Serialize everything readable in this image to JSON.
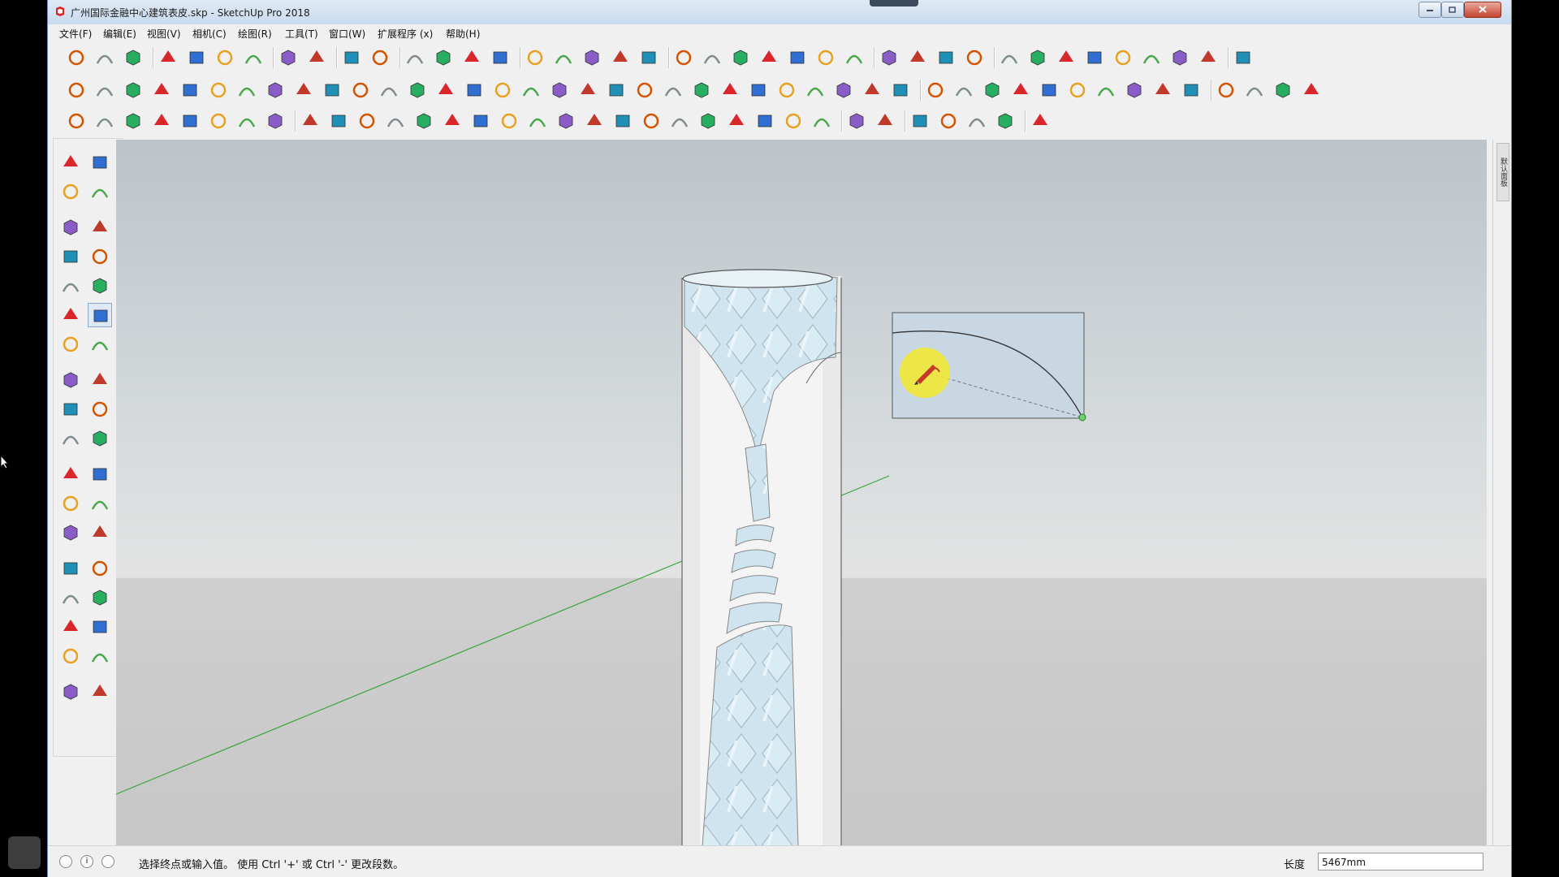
{
  "window": {
    "title": "广州国际金融中心建筑表皮.skp - SketchUp Pro 2018"
  },
  "menu": [
    "文件(F)",
    "编辑(E)",
    "视图(V)",
    "相机(C)",
    "绘图(R)",
    "工具(T)",
    "窗口(W)",
    "扩展程序 (x)",
    "帮助(H)"
  ],
  "toolbars": {
    "row1": [
      "new",
      "open",
      "save",
      "cut",
      "copy",
      "paste",
      "erase",
      "undo",
      "redo",
      "print",
      "model-info",
      "check",
      "tool-a",
      "tool-b",
      "tool-c",
      "tool-d",
      "tool-e",
      "tool-f",
      "tool-g",
      "tool-h",
      "tool-i",
      "tool-j",
      "tool-k",
      "tool-l",
      "tool-m",
      "tool-n",
      "tool-o",
      "style-xray",
      "style-back",
      "style-wire",
      "style-hidden",
      "style-shaded",
      "style-textured",
      "style-mono",
      "view-iso",
      "view-top",
      "view-front",
      "view-right",
      "view-back",
      "view-left"
    ],
    "row2_count": 44,
    "row3_count": 34
  },
  "left_tools": [
    "select-icon",
    "component-icon",
    "paint-bucket-icon",
    "eraser-icon",
    "pencil-icon",
    "freehand-icon",
    "rectangle-icon",
    "rotated-rect-icon",
    "circle-icon",
    "polygon-icon",
    "arc-icon",
    "two-point-arc-icon",
    "three-point-arc-icon",
    "pie-icon",
    "move-icon",
    "push-pull-icon",
    "rotate-icon",
    "follow-me-icon",
    "scale-icon",
    "offset-icon",
    "tape-measure-icon",
    "dimension-icon",
    "protractor-icon",
    "text-icon",
    "axes-icon",
    "3d-text-icon",
    "orbit-icon",
    "pan-icon",
    "zoom-icon",
    "zoom-window-icon",
    "zoom-extents-icon",
    "previous-view-icon",
    "position-camera-icon",
    "look-around-icon",
    "walk-icon",
    "section-plane-icon"
  ],
  "right_tray": {
    "tab_label": "默认面板"
  },
  "status": {
    "prompt": "选择终点或输入值。 使用 Ctrl '+' 或 Ctrl '-' 更改段数。",
    "measure_label": "长度",
    "measure_value": "5467mm"
  },
  "colors": {
    "sky": "#c3cbd0",
    "ground": "#c8c8c8",
    "glass": "#cfe3ec",
    "axis_green": "#3aa53a",
    "highlight": "#f2ea2a"
  }
}
